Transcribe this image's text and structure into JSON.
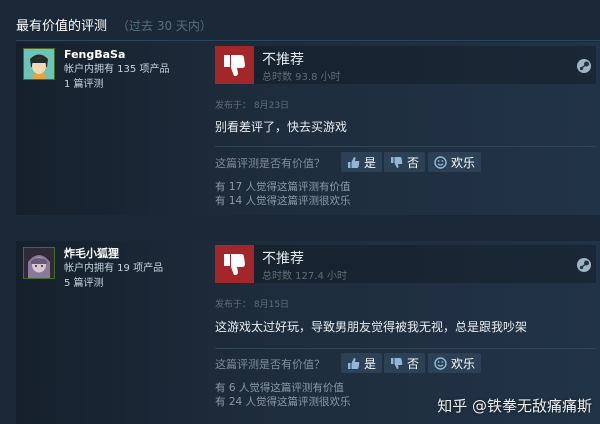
{
  "section": {
    "title": "最有价值的评测",
    "subtitle": "（过去 30 天内）"
  },
  "reviews": [
    {
      "author": "FengBaSa",
      "products": "帐户内拥有 135 项产品",
      "review_count": "1 篇评测",
      "verdict": "不推荐",
      "hours": "总时数 93.8 小时",
      "posted": "发布于：  8月23日",
      "content": "别看差评了，快去买游戏",
      "helpful_question": "这篇评测是否有价值？",
      "buttons": {
        "yes": "是",
        "no": "否",
        "funny": "欢乐"
      },
      "helpful_stat": "有 17 人觉得这篇评测有价值",
      "funny_stat": "有 14 人觉得这篇评测很欢乐"
    },
    {
      "author": "炸毛小狐狸",
      "products": "帐户内拥有 19 项产品",
      "review_count": "5 篇评测",
      "verdict": "不推荐",
      "hours": "总时数 127.4 小时",
      "posted": "发布于：  8月15日",
      "content": "这游戏太过好玩，导致男朋友觉得被我无视，总是跟我吵架",
      "helpful_question": "这篇评测是否有价值？",
      "buttons": {
        "yes": "是",
        "no": "否",
        "funny": "欢乐"
      },
      "helpful_stat": "有 6 人觉得这篇评测有价值",
      "funny_stat": "有 24 人觉得这篇评测很欢乐"
    }
  ],
  "watermark": "知乎 @铁拳无敌痛痛斯",
  "colors": {
    "background": "#1b2838",
    "thumb_down": "#a3262b",
    "button": "#2c4155"
  },
  "icons": [
    "thumbs-down-icon",
    "steam-icon",
    "thumbs-up-icon",
    "smiley-icon"
  ]
}
